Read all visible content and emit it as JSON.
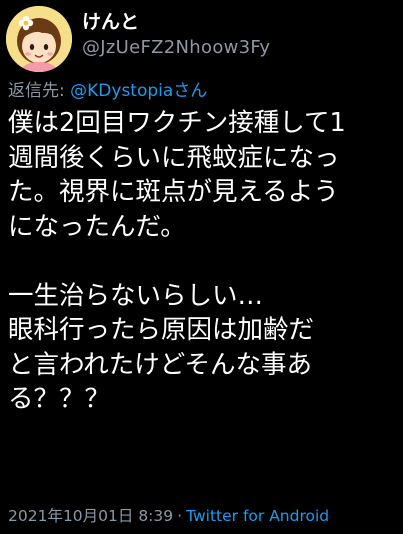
{
  "user": {
    "display_name": "けんと",
    "handle": "@JzUeFZ2Nhoow3Fy",
    "avatar_icon": "cartoon-avatar-icon"
  },
  "reply": {
    "prefix": "返信先: ",
    "mention": "@KDystopiaさん"
  },
  "tweet": {
    "lines": [
      "僕は2回目ワクチン接種して1",
      "週間後くらいに飛蚊症になっ",
      "た。視界に斑点が見えるよう",
      "になったんだ。",
      "",
      "一生治らないらしい…",
      "眼科行ったら原因は加齢だ",
      "と言われたけどそんな事あ",
      "る？？？"
    ]
  },
  "footer": {
    "timestamp": "2021年10月01日 8:39",
    "separator": "·",
    "source": "Twitter for Android"
  },
  "colors": {
    "background": "#000000",
    "text": "#ffffff",
    "muted": "#8b98a5",
    "link": "#1d9bf0"
  }
}
